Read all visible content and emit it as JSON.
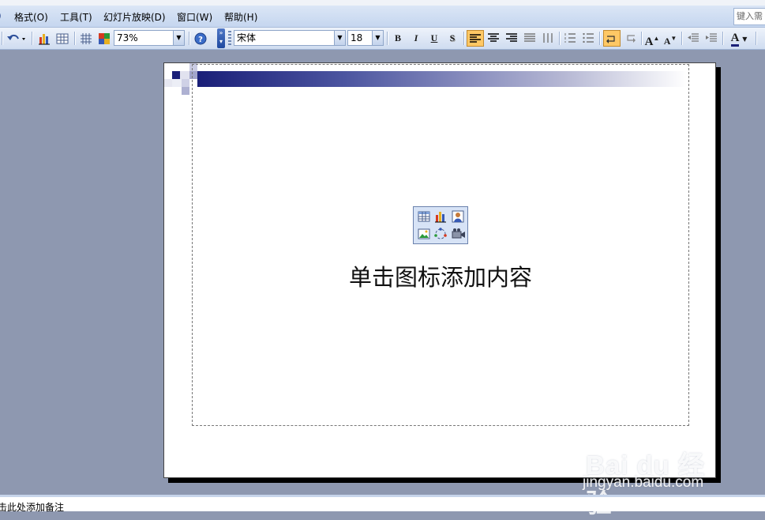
{
  "menu": {
    "cut_item": ")",
    "items": [
      "格式(O)",
      "工具(T)",
      "幻灯片放映(D)",
      "窗口(W)",
      "帮助(H)"
    ],
    "help_box_text": "键入需"
  },
  "toolbar": {
    "zoom": "73%",
    "font_name": "宋体",
    "font_size": "18",
    "bold": "B",
    "italic": "I",
    "underline": "U",
    "shadow": "S",
    "increase_font": "A",
    "decrease_font": "A",
    "font_color": "A",
    "icons": [
      "undo-icon",
      "chart-icon",
      "table-icon",
      "grid-icon",
      "color-icon",
      "help-icon",
      "align-left-icon",
      "align-center-icon",
      "align-right-icon",
      "justify-icon",
      "distribute-icon",
      "numbering-icon",
      "bullets-icon",
      "ltr-icon",
      "rtl-icon",
      "decrease-indent-icon",
      "increase-indent-icon"
    ],
    "active_alignment": "left"
  },
  "slide": {
    "prompt": "单击图标添加内容",
    "content_icons": [
      "insert-table-icon",
      "insert-chart-icon",
      "insert-clipart-icon",
      "insert-picture-icon",
      "insert-diagram-icon",
      "insert-media-icon"
    ]
  },
  "notes": {
    "text": "击此处添加备注"
  },
  "watermark": {
    "logo": "Bai du 经验",
    "url": "jingyan.baidu.com"
  },
  "colors": {
    "workspace": "#8e98b0",
    "accent_bar_start": "#1a1f78",
    "highlight": "#ffc865"
  }
}
